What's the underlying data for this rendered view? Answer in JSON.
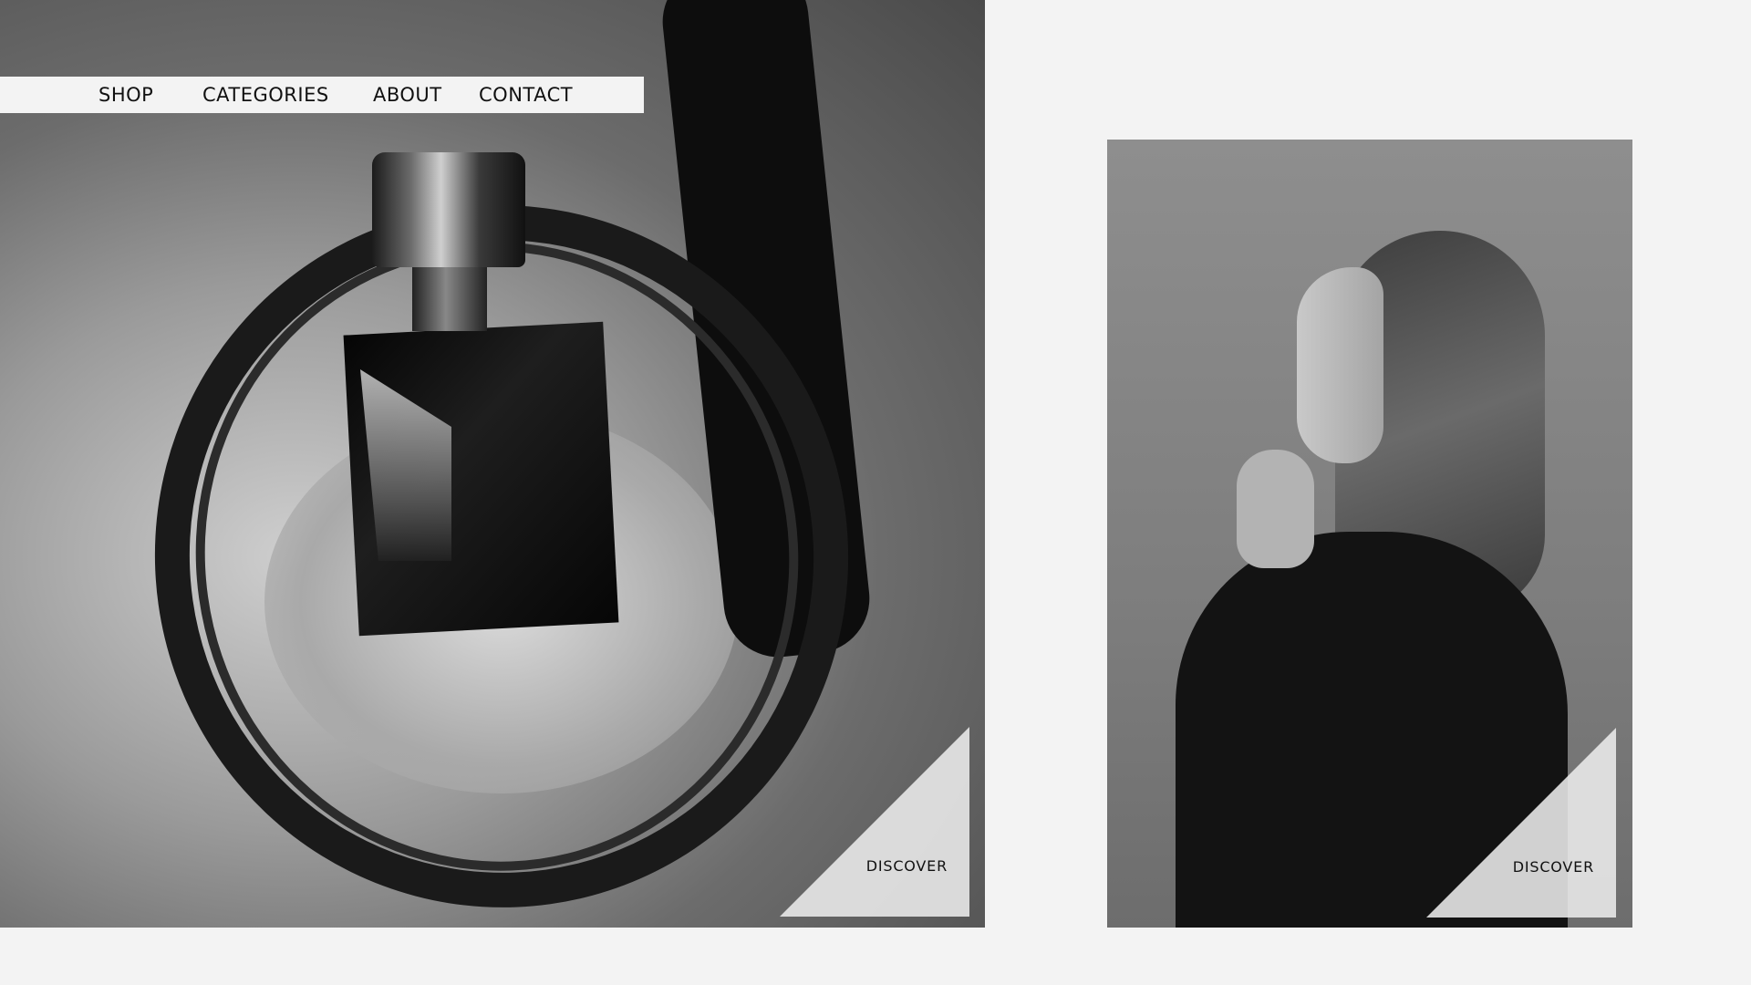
{
  "nav": {
    "items": [
      {
        "label": "SHOP"
      },
      {
        "label": "CATEGORIES"
      },
      {
        "label": "ABOUT"
      },
      {
        "label": "CONTACT"
      }
    ]
  },
  "hero": {
    "left": {
      "image": "perfume-bottle-on-leather-belt-photo",
      "cta_label": "DISCOVER"
    },
    "right": {
      "image": "woman-profile-portrait-photo",
      "cta_label": "DISCOVER"
    }
  },
  "colors": {
    "background": "#f3f3f3",
    "text": "#111111",
    "cta_panel": "#ececec"
  }
}
